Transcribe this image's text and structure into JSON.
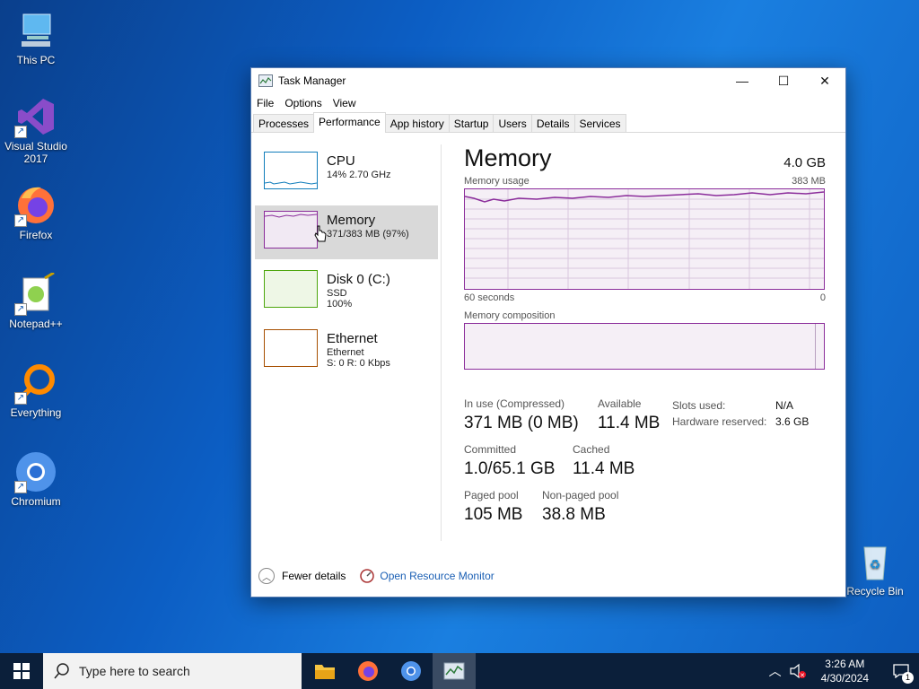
{
  "desktop": {
    "icons": [
      {
        "label": "This PC"
      },
      {
        "label": "Visual Studio\n2017"
      },
      {
        "label": "Firefox"
      },
      {
        "label": "Notepad++"
      },
      {
        "label": "Everything"
      },
      {
        "label": "Chromium"
      },
      {
        "label": "Recycle Bin"
      }
    ]
  },
  "window": {
    "title": "Task Manager",
    "menu": [
      "File",
      "Options",
      "View"
    ],
    "tabs": [
      "Processes",
      "Performance",
      "App history",
      "Startup",
      "Users",
      "Details",
      "Services"
    ],
    "active_tab": "Performance"
  },
  "resources": [
    {
      "name": "CPU",
      "sub": "14%  2.70 GHz",
      "sub2": "",
      "color": "#117dbb"
    },
    {
      "name": "Memory",
      "sub": "371/383 MB (97%)",
      "sub2": "",
      "color": "#8b2d9b"
    },
    {
      "name": "Disk 0 (C:)",
      "sub": "SSD",
      "sub2": "100%",
      "color": "#4da60c"
    },
    {
      "name": "Ethernet",
      "sub": "Ethernet",
      "sub2": "S: 0  R: 0 Kbps",
      "color": "#a74f01"
    }
  ],
  "memory": {
    "title": "Memory",
    "total": "4.0 GB",
    "usage_label": "Memory usage",
    "usage_max": "383 MB",
    "time_left": "60 seconds",
    "time_right": "0",
    "composition_label": "Memory composition",
    "stats": {
      "in_use_label": "In use (Compressed)",
      "in_use_value": "371 MB (0 MB)",
      "available_label": "Available",
      "available_value": "11.4 MB",
      "committed_label": "Committed",
      "committed_value": "1.0/65.1 GB",
      "cached_label": "Cached",
      "cached_value": "11.4 MB",
      "paged_label": "Paged pool",
      "paged_value": "105 MB",
      "nonpaged_label": "Non-paged pool",
      "nonpaged_value": "38.8 MB",
      "slots_label": "Slots used:",
      "slots_value": "N/A",
      "hw_label": "Hardware reserved:",
      "hw_value": "3.6 GB"
    }
  },
  "footer": {
    "fewer_details": "Fewer details",
    "open_monitor": "Open Resource Monitor"
  },
  "taskbar": {
    "search_placeholder": "Type here to search",
    "time": "3:26 AM",
    "date": "4/30/2024",
    "notification_count": "1"
  }
}
